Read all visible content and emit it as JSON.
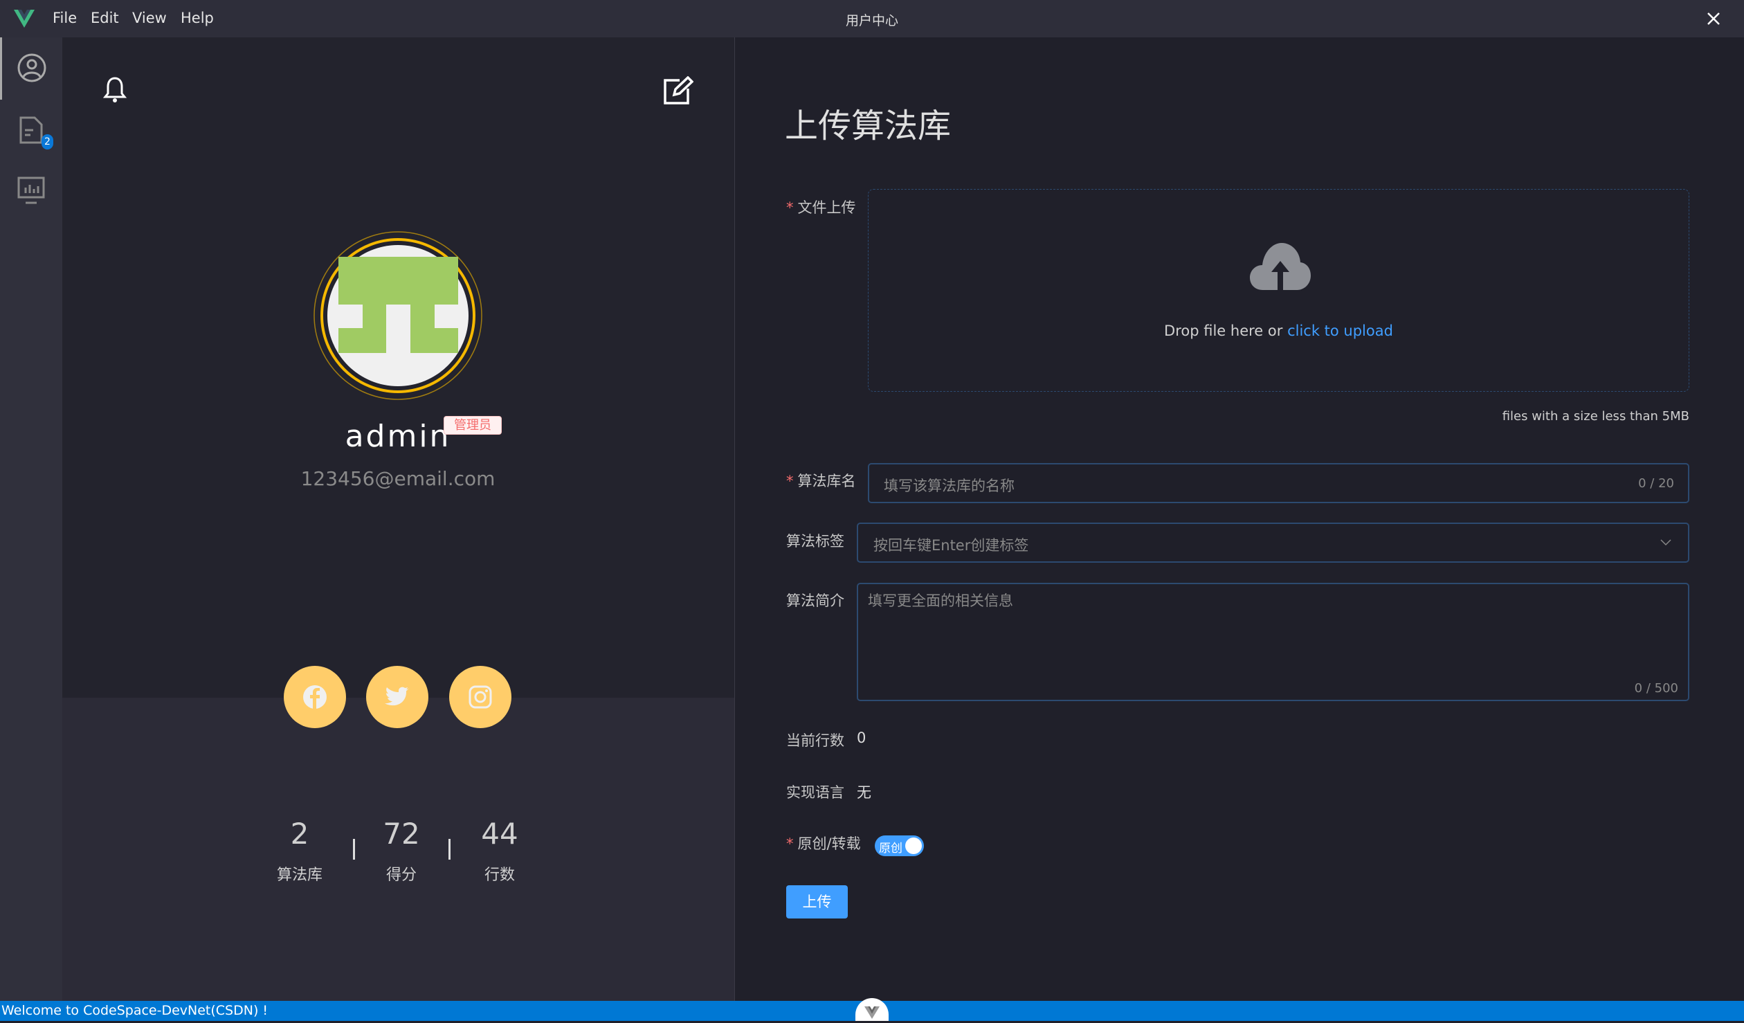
{
  "titlebar": {
    "title": "用户中心",
    "menu": [
      "File",
      "Edit",
      "View",
      "Help"
    ]
  },
  "sidebar": {
    "items": [
      {
        "icon": "user-icon",
        "active": true
      },
      {
        "icon": "document-icon",
        "badge": "2"
      },
      {
        "icon": "chart-monitor-icon"
      }
    ]
  },
  "profile": {
    "name": "admin",
    "role_badge": "管理员",
    "email": "123456@email.com",
    "stats": [
      {
        "value": "2",
        "label": "算法库"
      },
      {
        "value": "72",
        "label": "得分"
      },
      {
        "value": "44",
        "label": "行数"
      }
    ],
    "social": [
      "facebook-icon",
      "twitter-icon",
      "instagram-icon"
    ]
  },
  "form": {
    "title": "上传算法库",
    "upload": {
      "label": "文件上传",
      "drop_text": "Drop file here or ",
      "click_text": "click to upload",
      "tip": "files with a size less than 5MB"
    },
    "name": {
      "label": "算法库名",
      "placeholder": "填写该算法库的名称",
      "count": "0 / 20"
    },
    "tags": {
      "label": "算法标签",
      "placeholder": "按回车键Enter创建标签"
    },
    "desc": {
      "label": "算法简介",
      "placeholder": "填写更全面的相关信息",
      "count": "0 / 500"
    },
    "lines": {
      "label": "当前行数",
      "value": "0"
    },
    "lang": {
      "label": "实现语言",
      "value": "无"
    },
    "original": {
      "label": "原创/转载",
      "switch_text": "原创",
      "on": true
    },
    "submit": "上传"
  },
  "statusbar": {
    "text": "Welcome to CodeSpace-DevNet(CSDN) !"
  },
  "colors": {
    "accent": "#409eff",
    "status": "#0078d4",
    "social": "#ffcd6a",
    "ring": "#f5b800",
    "avatar_green": "#a0cb63"
  }
}
